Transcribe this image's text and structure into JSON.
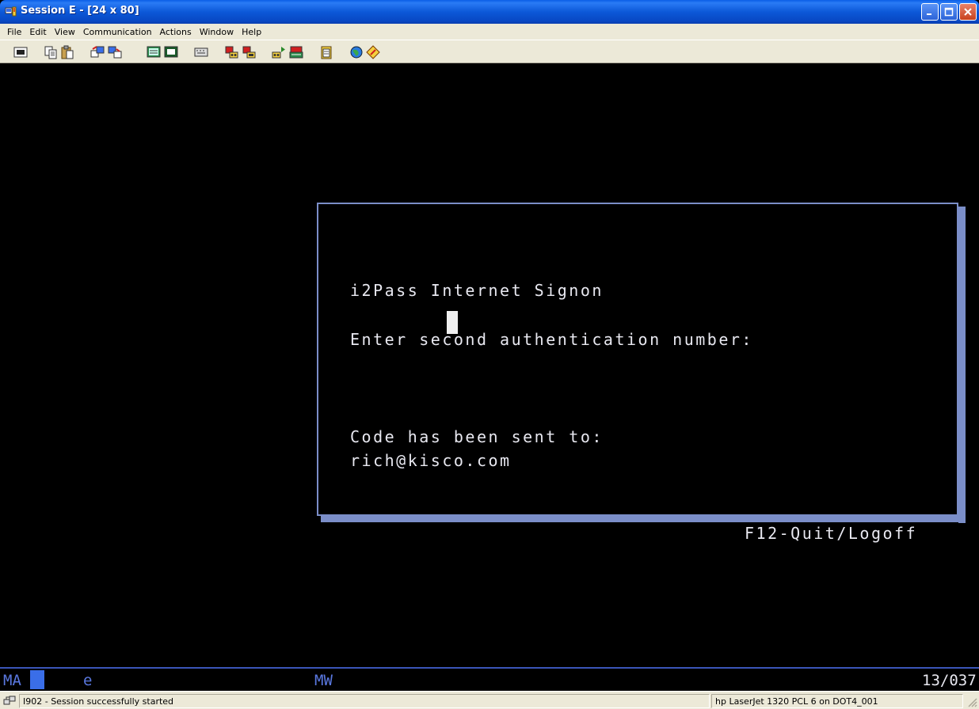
{
  "window": {
    "title": "Session E - [24 x 80]"
  },
  "menu": [
    "File",
    "Edit",
    "View",
    "Communication",
    "Actions",
    "Window",
    "Help"
  ],
  "toolbar_icons": [
    "print-screen-icon",
    "copy-icon",
    "paste-icon",
    "send-file-icon",
    "receive-file-icon",
    "display-setup-icon",
    "keyboard-map-icon",
    "macro-icon",
    "record-macro-icon",
    "stop-macro-icon",
    "play-macro-icon",
    "macro-list-icon",
    "clipboard-icon",
    "globe-icon",
    "help-diamond-icon"
  ],
  "terminal": {
    "dialog_title": "i2Pass Internet Signon",
    "prompt": "Enter second authentication number:",
    "sent_label": "Code has been sent to:",
    "email": "rich@kisco.com",
    "quit_hint": "F12-Quit/Logoff"
  },
  "oia": {
    "mode": "MA",
    "indicator": "e",
    "mw": "MW",
    "cursor_pos": "13/037"
  },
  "statusbar": {
    "message": "I902 - Session successfully started",
    "printer": "hp LaserJet 1320 PCL 6 on DOT4_001"
  },
  "colors": {
    "titlebar": "#0a58d8",
    "terminal_bg": "#000000",
    "terminal_text": "#e8e8f0",
    "dialog_border": "#7b8ec8",
    "oia_text": "#5a78e0"
  }
}
